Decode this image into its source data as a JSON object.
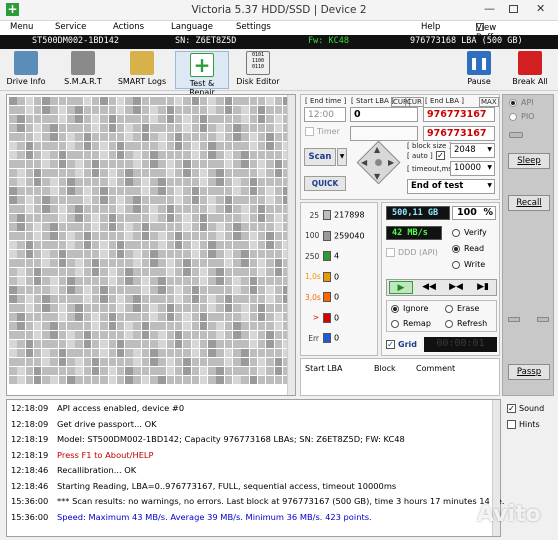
{
  "window": {
    "title": "Victoria 5.37 HDD/SSD | Device 2"
  },
  "menu": {
    "items": [
      "Menu",
      "Service",
      "Actions",
      "Language",
      "Settings",
      "Help"
    ],
    "view_buffer": "View Buffer Live"
  },
  "device_bar": {
    "model": "ST500DM002-1BD142",
    "serial": "SN: Z6ET8Z5D",
    "firmware": "Fw: KC48",
    "capacity": "976773168 LBA (500 GB)"
  },
  "toolbar": {
    "buttons": [
      "Drive Info",
      "S.M.A.R.T",
      "SMART Logs",
      "Test & Repair",
      "Disk Editor"
    ],
    "pause": "Pause",
    "break_all": "Break All"
  },
  "scan": {
    "end_time_label": "End time",
    "start_lba_label": "Start LBA",
    "cur_label": "CUR",
    "cur_label2": "CUR",
    "end_lba_label": "End LBA",
    "max_label": "MAX",
    "end_time_value": "12:00",
    "start_lba_value": "0",
    "end_lba_value": "976773167",
    "end_lba_value2": "976773167",
    "timer_label": "Timer",
    "scan_button": "Scan",
    "quick_button": "QUICK",
    "block_size_label": "block size",
    "auto_label": "auto",
    "block_size_value": "2048",
    "timeout_label": "timeout,ms",
    "timeout_value": "10000",
    "end_mode": "End of test"
  },
  "counters": [
    {
      "label": "25",
      "value": "217898"
    },
    {
      "label": "100",
      "value": "259040"
    },
    {
      "label": "250",
      "value": "4"
    },
    {
      "label": "1,0s",
      "value": "0"
    },
    {
      "label": "3,0s",
      "value": "0"
    },
    {
      "label": ">",
      "value": "0"
    },
    {
      "label": "Err",
      "value": "0"
    }
  ],
  "counter_colors": [
    "#bdbdbd",
    "#9a9a9a",
    "#2e9b3a",
    "#e89a00",
    "#ff6600",
    "#d40000",
    "#2457d6"
  ],
  "status": {
    "progress_gb": "500,11 GB",
    "percent": "100",
    "percent_unit": "%",
    "speed": "42 MB/s",
    "ddd_api": "DDD (API)",
    "verify": "Verify",
    "read": "Read",
    "write": "Write",
    "grid_label": "Grid",
    "timer": "00:00:01"
  },
  "actions": {
    "ignore": "Ignore",
    "erase": "Erase",
    "remap": "Remap",
    "refresh": "Refresh"
  },
  "defects_table": {
    "columns": [
      "Start LBA",
      "Block",
      "Comment"
    ]
  },
  "side_panel": {
    "api": "API",
    "pio": "PIO",
    "sleep": "Sleep",
    "recall": "Recall",
    "passp": "Passp"
  },
  "log_options": {
    "sound": "Sound",
    "hints": "Hints"
  },
  "log": [
    {
      "time": "12:18:09",
      "text": "API access enabled, device #0",
      "color": "#000000"
    },
    {
      "time": "12:18:09",
      "text": "Get drive passport... OK",
      "color": "#000000"
    },
    {
      "time": "12:18:19",
      "text": "Model: ST500DM002-1BD142; Capacity 976773168 LBAs; SN: Z6ET8Z5D; FW: KC48",
      "color": "#000000"
    },
    {
      "time": "12:18:19",
      "text": "Press F1 to About/HELP",
      "color": "#c00000"
    },
    {
      "time": "12:18:46",
      "text": "Recallibration... OK",
      "color": "#000000"
    },
    {
      "time": "12:18:46",
      "text": "Starting Reading, LBA=0..976773167, FULL, sequential access, timeout 10000ms",
      "color": "#000000"
    },
    {
      "time": "15:36:00",
      "text": "*** Scan results: no warnings, no errors. Last block at 976773167 (500 GB), time 3 hours 17 minutes 14 se.",
      "color": "#000000"
    },
    {
      "time": "15:36:00",
      "text": "Speed: Maximum 43 MB/s. Average 39 MB/s. Minimum 36 MB/s. 423 points.",
      "color": "#0000cc"
    }
  ],
  "watermark": "Avito"
}
